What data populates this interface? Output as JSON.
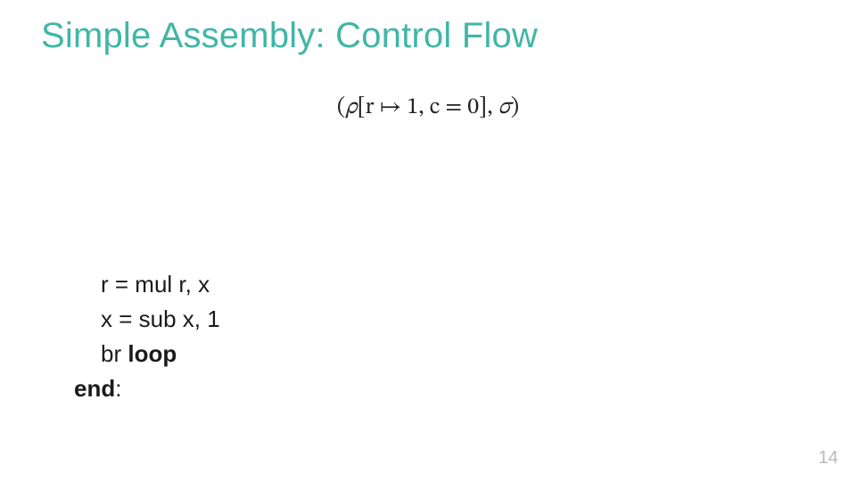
{
  "title": "Simple Assembly: Control Flow",
  "state": {
    "open": "(",
    "rho": "ρ",
    "lb": "[",
    "r": "r",
    "mapsto": " ↦ 1, ",
    "c": "c",
    "eq": " = 0",
    "rb": "]",
    "comma": ", ",
    "sigma": "σ",
    "close": ")"
  },
  "code": {
    "l1": "r = mul r, x",
    "l2": "x = sub x, 1",
    "l3_pre": "br ",
    "l3_kw": "loop",
    "l4_kw": "end",
    "l4_post": ":"
  },
  "pagenum": "14"
}
